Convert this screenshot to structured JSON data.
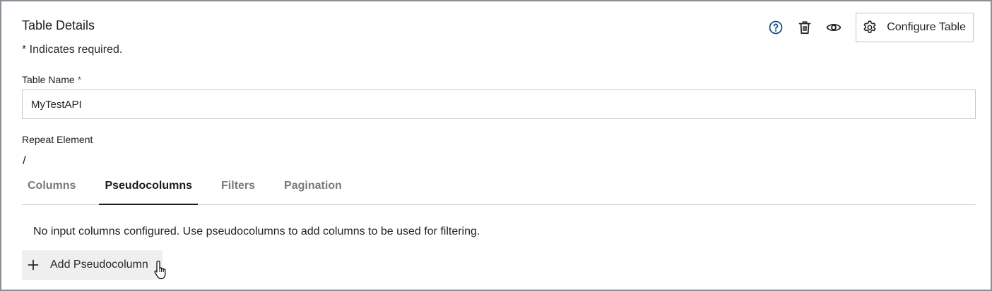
{
  "panel": {
    "title": "Table Details",
    "required_note": "* Indicates required."
  },
  "toolbar": {
    "icons": [
      "help-icon",
      "trash-icon",
      "eye-icon"
    ],
    "configure_label": "Configure Table",
    "help_color": "#1a4f8b"
  },
  "form": {
    "table_name_label": "Table Name",
    "required_marker": "*",
    "table_name_value": "MyTestAPI",
    "repeat_element_label": "Repeat Element",
    "repeat_element_value": "/"
  },
  "tabs": [
    {
      "label": "Columns",
      "active": false
    },
    {
      "label": "Pseudocolumns",
      "active": true
    },
    {
      "label": "Filters",
      "active": false
    },
    {
      "label": "Pagination",
      "active": false
    }
  ],
  "pseudocolumns": {
    "empty_message": "No input columns configured. Use pseudocolumns to add columns to be used for filtering.",
    "add_label": "Add Pseudocolumn"
  },
  "colors": {
    "required": "#d32f2f",
    "active_tab": "#1c1c1c",
    "inactive_tab": "#7a7a7a"
  }
}
